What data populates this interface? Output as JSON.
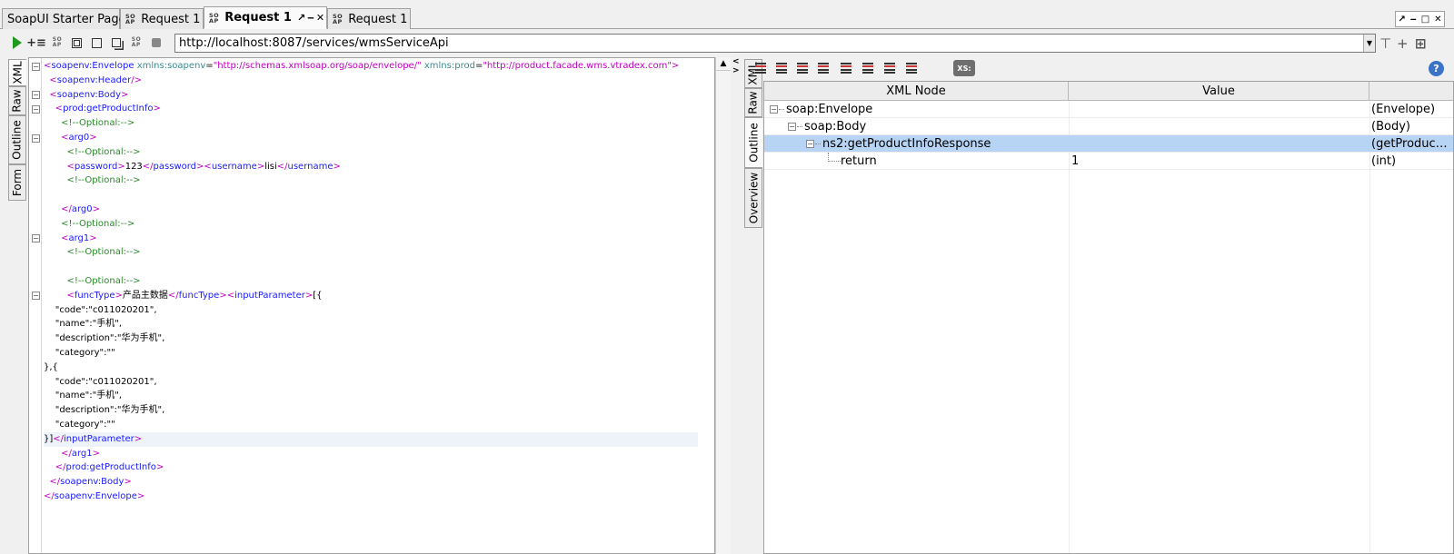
{
  "tabs": [
    {
      "label": "SoapUI Starter Page",
      "icon": "none"
    },
    {
      "label": "Request 1",
      "icon": "soap-icon"
    },
    {
      "label": "Request 1",
      "icon": "soap-icon",
      "active": true
    },
    {
      "label": "Request 1",
      "icon": "soap-icon"
    }
  ],
  "toolbar": {
    "url": "http://localhost:8087/services/wmsServiceApi"
  },
  "request_tabs": [
    "XML",
    "Raw",
    "Outline",
    "Form"
  ],
  "response_tabs": [
    "XML",
    "Raw",
    "Outline",
    "Overview"
  ],
  "request_xml": {
    "lines": [
      [
        [
          "tg",
          "<"
        ],
        [
          "tn",
          "soapenv:Envelope"
        ],
        [
          "at",
          " xmlns:soapenv"
        ],
        [
          "tx",
          "="
        ],
        [
          "av",
          "\"http://schemas.xmlsoap.org/soap/envelope/\""
        ],
        [
          "at",
          " xmlns:prod"
        ],
        [
          "tx",
          "="
        ],
        [
          "av",
          "\"http://product.facade.wms.vtradex.com\""
        ],
        [
          "tg",
          ">"
        ]
      ],
      [
        [
          "tx",
          "  "
        ],
        [
          "tg",
          "<"
        ],
        [
          "tn",
          "soapenv:Header"
        ],
        [
          "tg",
          "/>"
        ]
      ],
      [
        [
          "tx",
          "  "
        ],
        [
          "tg",
          "<"
        ],
        [
          "tn",
          "soapenv:Body"
        ],
        [
          "tg",
          ">"
        ]
      ],
      [
        [
          "tx",
          "    "
        ],
        [
          "tg",
          "<"
        ],
        [
          "tn",
          "prod:getProductInfo"
        ],
        [
          "tg",
          ">"
        ]
      ],
      [
        [
          "tx",
          "      "
        ],
        [
          "cm",
          "<!--Optional:-->"
        ]
      ],
      [
        [
          "tx",
          "      "
        ],
        [
          "tg",
          "<"
        ],
        [
          "tn",
          "arg0"
        ],
        [
          "tg",
          ">"
        ]
      ],
      [
        [
          "tx",
          "        "
        ],
        [
          "cm",
          "<!--Optional:-->"
        ]
      ],
      [
        [
          "tx",
          "        "
        ],
        [
          "tg",
          "<"
        ],
        [
          "tn",
          "password"
        ],
        [
          "tg",
          ">"
        ],
        [
          "tx",
          "123"
        ],
        [
          "tg",
          "</"
        ],
        [
          "tn",
          "password"
        ],
        [
          "tg",
          ">"
        ],
        [
          "tg",
          "<"
        ],
        [
          "tn",
          "username"
        ],
        [
          "tg",
          ">"
        ],
        [
          "tx",
          "lisi"
        ],
        [
          "tg",
          "</"
        ],
        [
          "tn",
          "username"
        ],
        [
          "tg",
          ">"
        ]
      ],
      [
        [
          "tx",
          "        "
        ],
        [
          "cm",
          "<!--Optional:-->"
        ]
      ],
      [],
      [
        [
          "tx",
          "      "
        ],
        [
          "tg",
          "</"
        ],
        [
          "tn",
          "arg0"
        ],
        [
          "tg",
          ">"
        ]
      ],
      [
        [
          "tx",
          "      "
        ],
        [
          "cm",
          "<!--Optional:-->"
        ]
      ],
      [
        [
          "tx",
          "      "
        ],
        [
          "tg",
          "<"
        ],
        [
          "tn",
          "arg1"
        ],
        [
          "tg",
          ">"
        ]
      ],
      [
        [
          "tx",
          "        "
        ],
        [
          "cm",
          "<!--Optional:-->"
        ]
      ],
      [],
      [
        [
          "tx",
          "        "
        ],
        [
          "cm",
          "<!--Optional:-->"
        ]
      ],
      [
        [
          "tx",
          "        "
        ],
        [
          "tg",
          "<"
        ],
        [
          "tn",
          "funcType"
        ],
        [
          "tg",
          ">"
        ],
        [
          "tx",
          "产品主数据"
        ],
        [
          "tg",
          "</"
        ],
        [
          "tn",
          "funcType"
        ],
        [
          "tg",
          ">"
        ],
        [
          "tg",
          "<"
        ],
        [
          "tn",
          "inputParameter"
        ],
        [
          "tg",
          ">"
        ],
        [
          "tx",
          "[{"
        ]
      ],
      [
        [
          "tx",
          "    \"code\":\"c011020201\","
        ]
      ],
      [
        [
          "tx",
          "    \"name\":\"手机\","
        ]
      ],
      [
        [
          "tx",
          "    \"description\":\"华为手机\","
        ]
      ],
      [
        [
          "tx",
          "    \"category\":\"\""
        ]
      ],
      [
        [
          "tx",
          "},{"
        ]
      ],
      [
        [
          "tx",
          "    \"code\":\"c011020201\","
        ]
      ],
      [
        [
          "tx",
          "    \"name\":\"手机\","
        ]
      ],
      [
        [
          "tx",
          "    \"description\":\"华为手机\","
        ]
      ],
      [
        [
          "tx",
          "    \"category\":\"\""
        ]
      ],
      [
        [
          "tx",
          "}]"
        ],
        [
          "tg",
          "</"
        ],
        [
          "tn",
          "inputParameter"
        ],
        [
          "tg",
          ">"
        ]
      ],
      [
        [
          "tx",
          "      "
        ],
        [
          "tg",
          "</"
        ],
        [
          "tn",
          "arg1"
        ],
        [
          "tg",
          ">"
        ]
      ],
      [
        [
          "tx",
          "    "
        ],
        [
          "tg",
          "</"
        ],
        [
          "tn",
          "prod:getProductInfo"
        ],
        [
          "tg",
          ">"
        ]
      ],
      [
        [
          "tx",
          "  "
        ],
        [
          "tg",
          "</"
        ],
        [
          "tn",
          "soapenv:Body"
        ],
        [
          "tg",
          ">"
        ]
      ],
      [
        [
          "tg",
          "</"
        ],
        [
          "tn",
          "soapenv:Envelope"
        ],
        [
          "tg",
          ">"
        ]
      ]
    ],
    "fold_lines": [
      0,
      2,
      3,
      5,
      12,
      16
    ],
    "highlight_line": 26
  },
  "response_tree": {
    "headers": [
      "XML Node",
      "Value",
      ""
    ],
    "rows": [
      {
        "node": "soap:Envelope",
        "value": "",
        "type": "(Envelope)",
        "depth": 0,
        "foldable": true,
        "selected": false
      },
      {
        "node": "soap:Body",
        "value": "",
        "type": "(Body)",
        "depth": 1,
        "foldable": true,
        "selected": false
      },
      {
        "node": "ns2:getProductInfoResponse",
        "value": "",
        "type": "(getProduc…",
        "depth": 2,
        "foldable": true,
        "selected": true
      },
      {
        "node": "return",
        "value": "1",
        "type": "(int)",
        "depth": 3,
        "foldable": false,
        "selected": false
      }
    ]
  },
  "colors": {
    "accent_green": "#1e9a1e",
    "selection": "#b8d4f4",
    "tag": "#c000c0",
    "tag_name": "#1a1aff",
    "comment": "#2a8a2a"
  }
}
